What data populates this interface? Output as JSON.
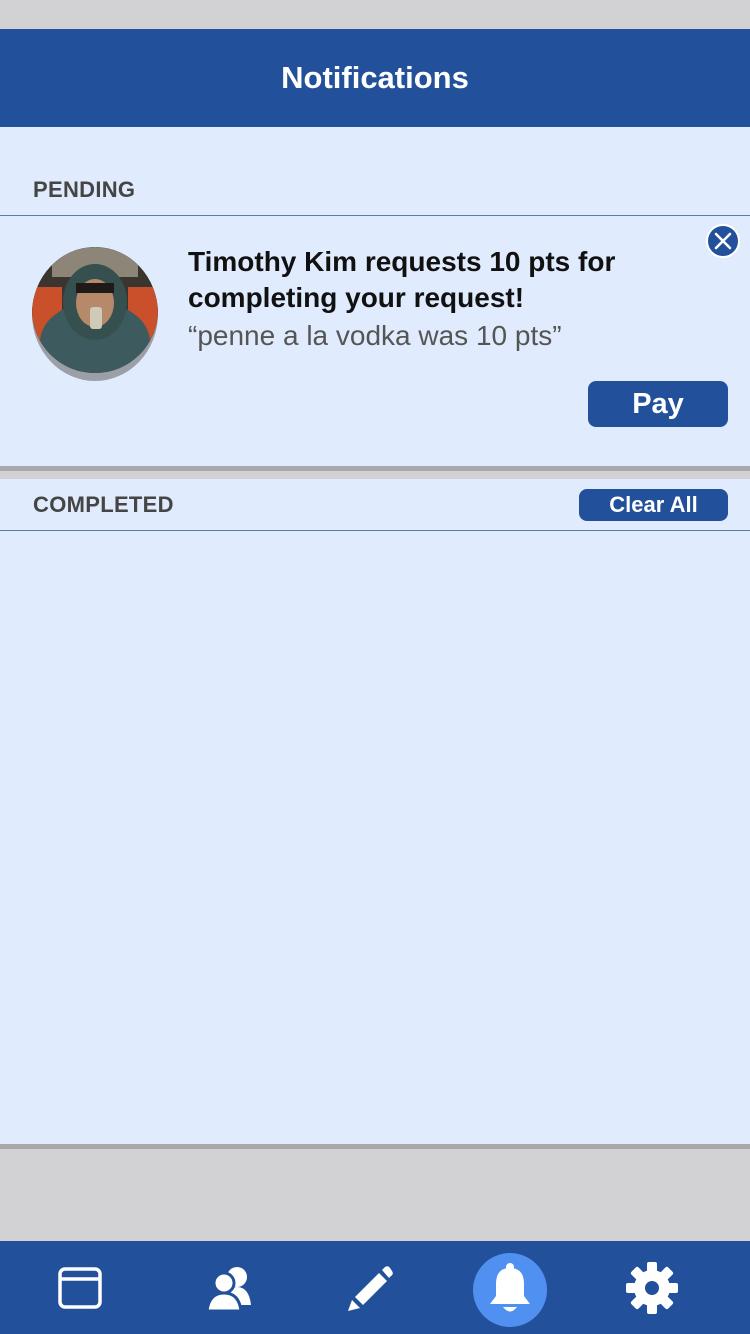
{
  "header": {
    "title": "Notifications"
  },
  "pending": {
    "label": "PENDING",
    "request": {
      "title": "Timothy Kim requests 10 pts for completing your request!",
      "quote": "“penne a la vodka was 10 pts”",
      "pay_label": "Pay",
      "dismiss_icon": "close-icon",
      "avatar_icon": "avatar"
    }
  },
  "completed": {
    "label": "COMPLETED",
    "clear_label": "Clear All"
  },
  "tabs": [
    {
      "icon": "browser-window-icon"
    },
    {
      "icon": "users-icon"
    },
    {
      "icon": "pencil-icon"
    },
    {
      "icon": "bell-icon",
      "active": true
    },
    {
      "icon": "gear-icon"
    }
  ],
  "colors": {
    "primary": "#23509b",
    "background": "#e0ecfd",
    "active_tab": "#4f90f0",
    "gray": "#d2d2d4"
  }
}
